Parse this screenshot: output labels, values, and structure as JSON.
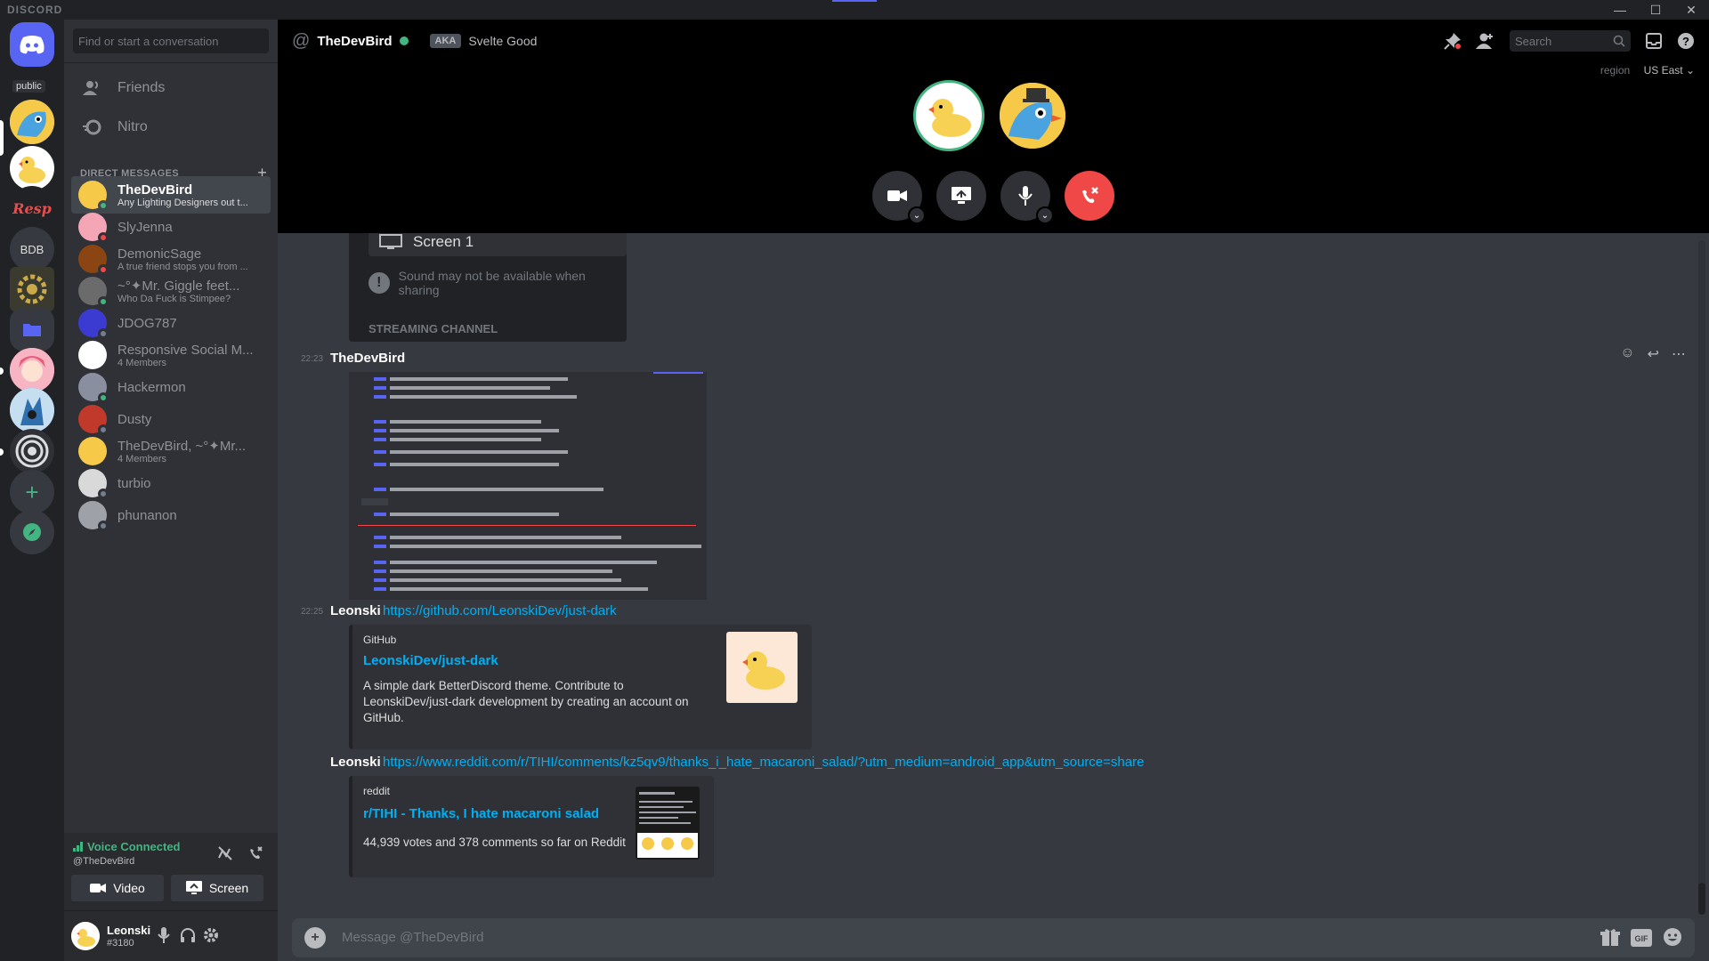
{
  "app": {
    "brand": "DISCORD",
    "window_controls": [
      "—",
      "☐",
      "✕"
    ]
  },
  "guilds": {
    "public_label": "public",
    "bdb_label": "BDB",
    "resp_label": "Resp"
  },
  "sidebar": {
    "search_placeholder": "Find or start a conversation",
    "nav": [
      {
        "label": "Friends",
        "icon": "friends-icon"
      },
      {
        "label": "Nitro",
        "icon": "nitro-icon"
      }
    ],
    "dm_header": "DIRECT MESSAGES",
    "dms": [
      {
        "name": "TheDevBird",
        "sub": "Any Lighting Designers out t...",
        "status": "online",
        "active": true
      },
      {
        "name": "SlyJenna",
        "sub": "",
        "status": "dnd"
      },
      {
        "name": "DemonicSage",
        "sub": "A true friend stops you from ...",
        "status": "dnd"
      },
      {
        "name": "~°✦Mr. Giggle feet...",
        "sub": "Who Da Fuck is Stimpee?",
        "status": "online"
      },
      {
        "name": "JDOG787",
        "sub": "",
        "status": "offline"
      },
      {
        "name": "Responsive Social M...",
        "sub": "4 Members",
        "status": ""
      },
      {
        "name": "Hackermon",
        "sub": "",
        "status": "online"
      },
      {
        "name": "Dusty",
        "sub": "",
        "status": "offline"
      },
      {
        "name": "TheDevBird, ~°✦Mr...",
        "sub": "4 Members",
        "status": ""
      },
      {
        "name": "turbio",
        "sub": "",
        "status": "offline"
      },
      {
        "name": "phunanon",
        "sub": "",
        "status": "offline"
      }
    ]
  },
  "voice": {
    "status": "Voice Connected",
    "channel": "@TheDevBird",
    "video_label": "Video",
    "screen_label": "Screen"
  },
  "user": {
    "name": "Leonski",
    "tag": "#3180"
  },
  "header": {
    "title": "TheDevBird",
    "aka": "AKA",
    "aka_name": "Svelte Good",
    "search_placeholder": "Search",
    "region_label": "region",
    "region_value": "US East"
  },
  "stream_popup": {
    "screen_label": "Screen 1",
    "warning": "Sound may not be available when sharing",
    "section": "STREAMING CHANNEL"
  },
  "messages": [
    {
      "time": "22:23",
      "author": "TheDevBird",
      "type": "image"
    },
    {
      "time": "22:25",
      "author": "Leonski",
      "link": "https://github.com/LeonskiDev/just-dark",
      "embed": {
        "provider": "GitHub",
        "title": "LeonskiDev/just-dark",
        "desc": "A simple dark BetterDiscord theme. Contribute to LeonskiDev/just-dark development by creating an account on GitHub."
      }
    },
    {
      "time": "",
      "author": "Leonski",
      "link": "https://www.reddit.com/r/TIHI/comments/kz5qv9/thanks_i_hate_macaroni_salad/?utm_medium=android_app&utm_source=share",
      "embed": {
        "provider": "reddit",
        "title": "r/TIHI - Thanks, I hate macaroni salad",
        "desc": "44,939 votes and 378 comments so far on Reddit"
      }
    }
  ],
  "composer": {
    "placeholder": "Message @TheDevBird"
  },
  "colors": {
    "accent": "#5865f2",
    "online": "#43b581",
    "dnd": "#f04747",
    "link": "#00b0f4",
    "hangup": "#f04747"
  }
}
